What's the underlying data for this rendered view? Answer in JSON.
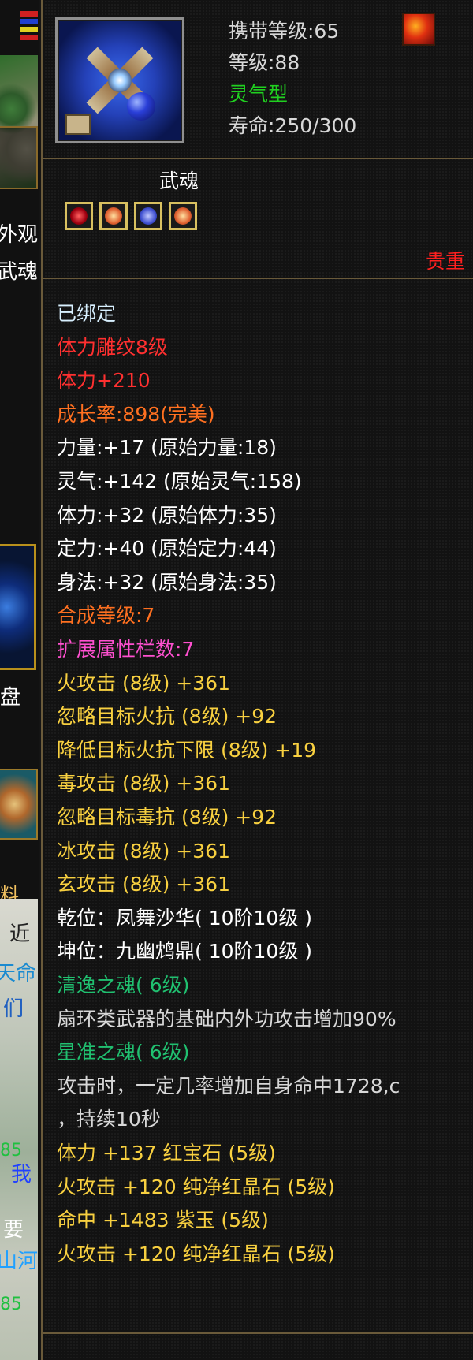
{
  "colors": {
    "white": "#ffffff",
    "red": "#ff3030",
    "orange": "#ff7020",
    "yellow": "#f8d040",
    "pink": "#ff50d0",
    "green": "#20d020",
    "teal": "#20c070",
    "light_gray": "#d8d8d8",
    "pale_cyan": "#d8f0ff",
    "stat_gray": "#d8d8d8"
  },
  "left_strip": {
    "texts": [
      "外观",
      "武魂",
      "盘",
      "料",
      "近",
      "天命",
      "们",
      "我",
      "要",
      "山河",
      "85",
      "85"
    ]
  },
  "header": {
    "carry_level": "携带等级:65",
    "level": "等级:88",
    "type": "灵气型",
    "lifespan": "寿命:250/300",
    "icon": "shuriken-icon",
    "badge_icon": "fire-emblem-icon"
  },
  "soul": {
    "title": "武魂",
    "gems": [
      "red-gem-icon",
      "orange-gem-icon",
      "blue-gem-icon",
      "orange-gem-icon"
    ],
    "valuable_label": "贵重"
  },
  "attributes": [
    {
      "text": "已绑定",
      "color": "pale_cyan"
    },
    {
      "text": "体力雕纹8级",
      "color": "red"
    },
    {
      "text": "体力+210",
      "color": "red"
    },
    {
      "text": "成长率:898(完美)",
      "color": "orange"
    },
    {
      "text": "力量:+17 (原始力量:18)",
      "color": "white"
    },
    {
      "text": "灵气:+142 (原始灵气:158)",
      "color": "white"
    },
    {
      "text": "体力:+32 (原始体力:35)",
      "color": "white"
    },
    {
      "text": "定力:+40 (原始定力:44)",
      "color": "white"
    },
    {
      "text": "身法:+32 (原始身法:35)",
      "color": "white"
    },
    {
      "text": "合成等级:7",
      "color": "orange"
    },
    {
      "text": "扩展属性栏数:7",
      "color": "pink"
    },
    {
      "text": "火攻击 (8级) +361",
      "color": "yellow"
    },
    {
      "text": "忽略目标火抗 (8级) +92",
      "color": "yellow"
    },
    {
      "text": "降低目标火抗下限 (8级) +19",
      "color": "yellow"
    },
    {
      "text": "毒攻击 (8级) +361",
      "color": "yellow"
    },
    {
      "text": "忽略目标毒抗 (8级) +92",
      "color": "yellow"
    },
    {
      "text": "冰攻击 (8级) +361",
      "color": "yellow"
    },
    {
      "text": "玄攻击 (8级) +361",
      "color": "yellow"
    },
    {
      "text": "乾位：凤舞沙华( 10阶10级 )",
      "color": "white"
    },
    {
      "text": "坤位：九幽鸩鼎( 10阶10级 )",
      "color": "white"
    },
    {
      "text": "清逸之魂( 6级)",
      "color": "teal"
    },
    {
      "text": "扇环类武器的基础内外功攻击增加90%",
      "color": "light_gray"
    },
    {
      "text": "星准之魂( 6级)",
      "color": "teal"
    },
    {
      "text": "攻击时，一定几率增加自身命中1728,c",
      "color": "light_gray"
    },
    {
      "text": "，持续10秒",
      "color": "light_gray"
    },
    {
      "text": "体力 +137 红宝石 (5级)",
      "color": "yellow"
    },
    {
      "text": "火攻击 +120 纯净红晶石 (5级)",
      "color": "yellow"
    },
    {
      "text": "命中 +1483 紫玉 (5级)",
      "color": "yellow"
    },
    {
      "text": "火攻击 +120 纯净红晶石 (5级)",
      "color": "yellow"
    }
  ]
}
